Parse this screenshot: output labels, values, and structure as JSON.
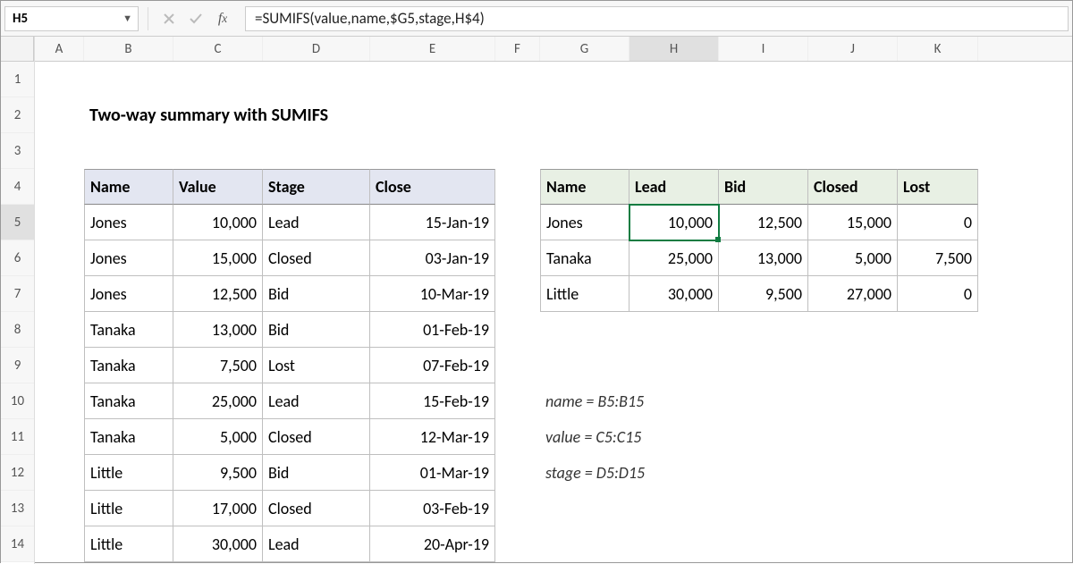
{
  "name_box": "H5",
  "formula": "=SUMIFS(value,name,$G5,stage,H$4)",
  "title": "Two-way summary with SUMIFS",
  "columns": [
    "A",
    "B",
    "C",
    "D",
    "E",
    "F",
    "G",
    "H",
    "I",
    "J",
    "K"
  ],
  "active_col": "H",
  "row_nums": [
    "1",
    "2",
    "3",
    "4",
    "5",
    "6",
    "7",
    "8",
    "9",
    "10",
    "11",
    "12",
    "13",
    "14"
  ],
  "active_row": "5",
  "tbl1": {
    "headers": [
      "Name",
      "Value",
      "Stage",
      "Close"
    ],
    "rows": [
      [
        "Jones",
        "10,000",
        "Lead",
        "15-Jan-19"
      ],
      [
        "Jones",
        "15,000",
        "Closed",
        "03-Jan-19"
      ],
      [
        "Jones",
        "12,500",
        "Bid",
        "10-Mar-19"
      ],
      [
        "Tanaka",
        "13,000",
        "Bid",
        "01-Feb-19"
      ],
      [
        "Tanaka",
        "7,500",
        "Lost",
        "07-Feb-19"
      ],
      [
        "Tanaka",
        "25,000",
        "Lead",
        "15-Feb-19"
      ],
      [
        "Tanaka",
        "5,000",
        "Closed",
        "12-Mar-19"
      ],
      [
        "Little",
        "9,500",
        "Bid",
        "01-Mar-19"
      ],
      [
        "Little",
        "17,000",
        "Closed",
        "03-Feb-19"
      ],
      [
        "Little",
        "30,000",
        "Lead",
        "20-Apr-19"
      ]
    ]
  },
  "tbl2": {
    "headers": [
      "Name",
      "Lead",
      "Bid",
      "Closed",
      "Lost"
    ],
    "rows": [
      [
        "Jones",
        "10,000",
        "12,500",
        "15,000",
        "0"
      ],
      [
        "Tanaka",
        "25,000",
        "13,000",
        "5,000",
        "7,500"
      ],
      [
        "Little",
        "30,000",
        "9,500",
        "27,000",
        "0"
      ]
    ]
  },
  "notes": {
    "n1": "name = B5:B15",
    "n2": "value = C5:C15",
    "n3": "stage = D5:D15"
  }
}
